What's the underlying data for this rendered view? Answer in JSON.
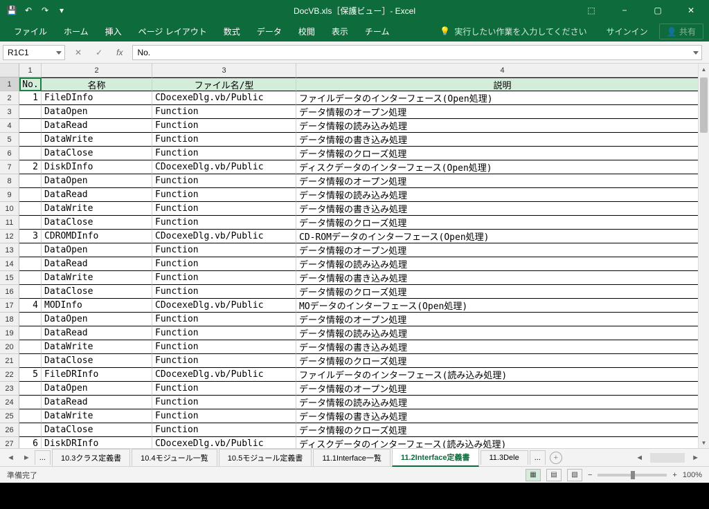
{
  "titlebar": {
    "title": "DocVB.xls［保護ビュー］- Excel"
  },
  "qat": {
    "save": "💾",
    "undo": "↶",
    "redo": "↷",
    "more": "▾"
  },
  "winctrl": {
    "ribbon": "⬚",
    "min": "−",
    "max": "▢",
    "close": "✕"
  },
  "tabs": [
    "ファイル",
    "ホーム",
    "挿入",
    "ページ レイアウト",
    "数式",
    "データ",
    "校閲",
    "表示",
    "チーム"
  ],
  "tellme": "実行したい作業を入力してください",
  "signin": "サインイン",
  "share": "共有",
  "namebox": "R1C1",
  "formula": "No.",
  "colnums": [
    "1",
    "2",
    "3",
    "4"
  ],
  "headers": {
    "c1": "No.",
    "c2": "名称",
    "c3": "ファイル名/型",
    "c4": "説明"
  },
  "rows": [
    {
      "n": "1",
      "no": "1",
      "name": "FileDInfo",
      "file": "CDocexeDlg.vb/Public",
      "desc": "ファイルデータのインターフェース(Open処理)"
    },
    {
      "n": "2",
      "no": "",
      "name": "DataOpen",
      "file": "Function",
      "desc": "データ情報のオープン処理"
    },
    {
      "n": "3",
      "no": "",
      "name": "DataRead",
      "file": "Function",
      "desc": "データ情報の読み込み処理"
    },
    {
      "n": "4",
      "no": "",
      "name": "DataWrite",
      "file": "Function",
      "desc": "データ情報の書き込み処理"
    },
    {
      "n": "5",
      "no": "",
      "name": "DataClose",
      "file": "Function",
      "desc": "データ情報のクローズ処理"
    },
    {
      "n": "6",
      "no": "2",
      "name": "DiskDInfo",
      "file": "CDocexeDlg.vb/Public",
      "desc": "ディスクデータのインターフェース(Open処理)"
    },
    {
      "n": "7",
      "no": "",
      "name": "DataOpen",
      "file": "Function",
      "desc": "データ情報のオープン処理"
    },
    {
      "n": "8",
      "no": "",
      "name": "DataRead",
      "file": "Function",
      "desc": "データ情報の読み込み処理"
    },
    {
      "n": "9",
      "no": "",
      "name": "DataWrite",
      "file": "Function",
      "desc": "データ情報の書き込み処理"
    },
    {
      "n": "10",
      "no": "",
      "name": "DataClose",
      "file": "Function",
      "desc": "データ情報のクローズ処理"
    },
    {
      "n": "11",
      "no": "3",
      "name": "CDROMDInfo",
      "file": "CDocexeDlg.vb/Public",
      "desc": "CD-ROMデータのインターフェース(Open処理)"
    },
    {
      "n": "12",
      "no": "",
      "name": "DataOpen",
      "file": "Function",
      "desc": "データ情報のオープン処理"
    },
    {
      "n": "13",
      "no": "",
      "name": "DataRead",
      "file": "Function",
      "desc": "データ情報の読み込み処理"
    },
    {
      "n": "14",
      "no": "",
      "name": "DataWrite",
      "file": "Function",
      "desc": "データ情報の書き込み処理"
    },
    {
      "n": "15",
      "no": "",
      "name": "DataClose",
      "file": "Function",
      "desc": "データ情報のクローズ処理"
    },
    {
      "n": "16",
      "no": "4",
      "name": "MODInfo",
      "file": "CDocexeDlg.vb/Public",
      "desc": "MOデータのインターフェース(Open処理)"
    },
    {
      "n": "17",
      "no": "",
      "name": "DataOpen",
      "file": "Function",
      "desc": "データ情報のオープン処理"
    },
    {
      "n": "18",
      "no": "",
      "name": "DataRead",
      "file": "Function",
      "desc": "データ情報の読み込み処理"
    },
    {
      "n": "19",
      "no": "",
      "name": "DataWrite",
      "file": "Function",
      "desc": "データ情報の書き込み処理"
    },
    {
      "n": "20",
      "no": "",
      "name": "DataClose",
      "file": "Function",
      "desc": "データ情報のクローズ処理"
    },
    {
      "n": "21",
      "no": "5",
      "name": "FileDRInfo",
      "file": "CDocexeDlg.vb/Public",
      "desc": "ファイルデータのインターフェース(読み込み処理)"
    },
    {
      "n": "22",
      "no": "",
      "name": "DataOpen",
      "file": "Function",
      "desc": "データ情報のオープン処理"
    },
    {
      "n": "23",
      "no": "",
      "name": "DataRead",
      "file": "Function",
      "desc": "データ情報の読み込み処理"
    },
    {
      "n": "24",
      "no": "",
      "name": "DataWrite",
      "file": "Function",
      "desc": "データ情報の書き込み処理"
    },
    {
      "n": "25",
      "no": "",
      "name": "DataClose",
      "file": "Function",
      "desc": "データ情報のクローズ処理"
    },
    {
      "n": "26",
      "no": "6",
      "name": "DiskDRInfo",
      "file": "CDocexeDlg.vb/Public",
      "desc": "ディスクデータのインターフェース(読み込み処理)"
    }
  ],
  "sheets": {
    "ellipsis": "...",
    "items": [
      "10.3クラス定義書",
      "10.4モジュール一覧",
      "10.5モジュール定義書",
      "11.1Interface一覧",
      "11.2Interface定義書",
      "11.3Dele"
    ],
    "more": "..."
  },
  "status": {
    "ready": "準備完了",
    "zoom": "100%"
  }
}
